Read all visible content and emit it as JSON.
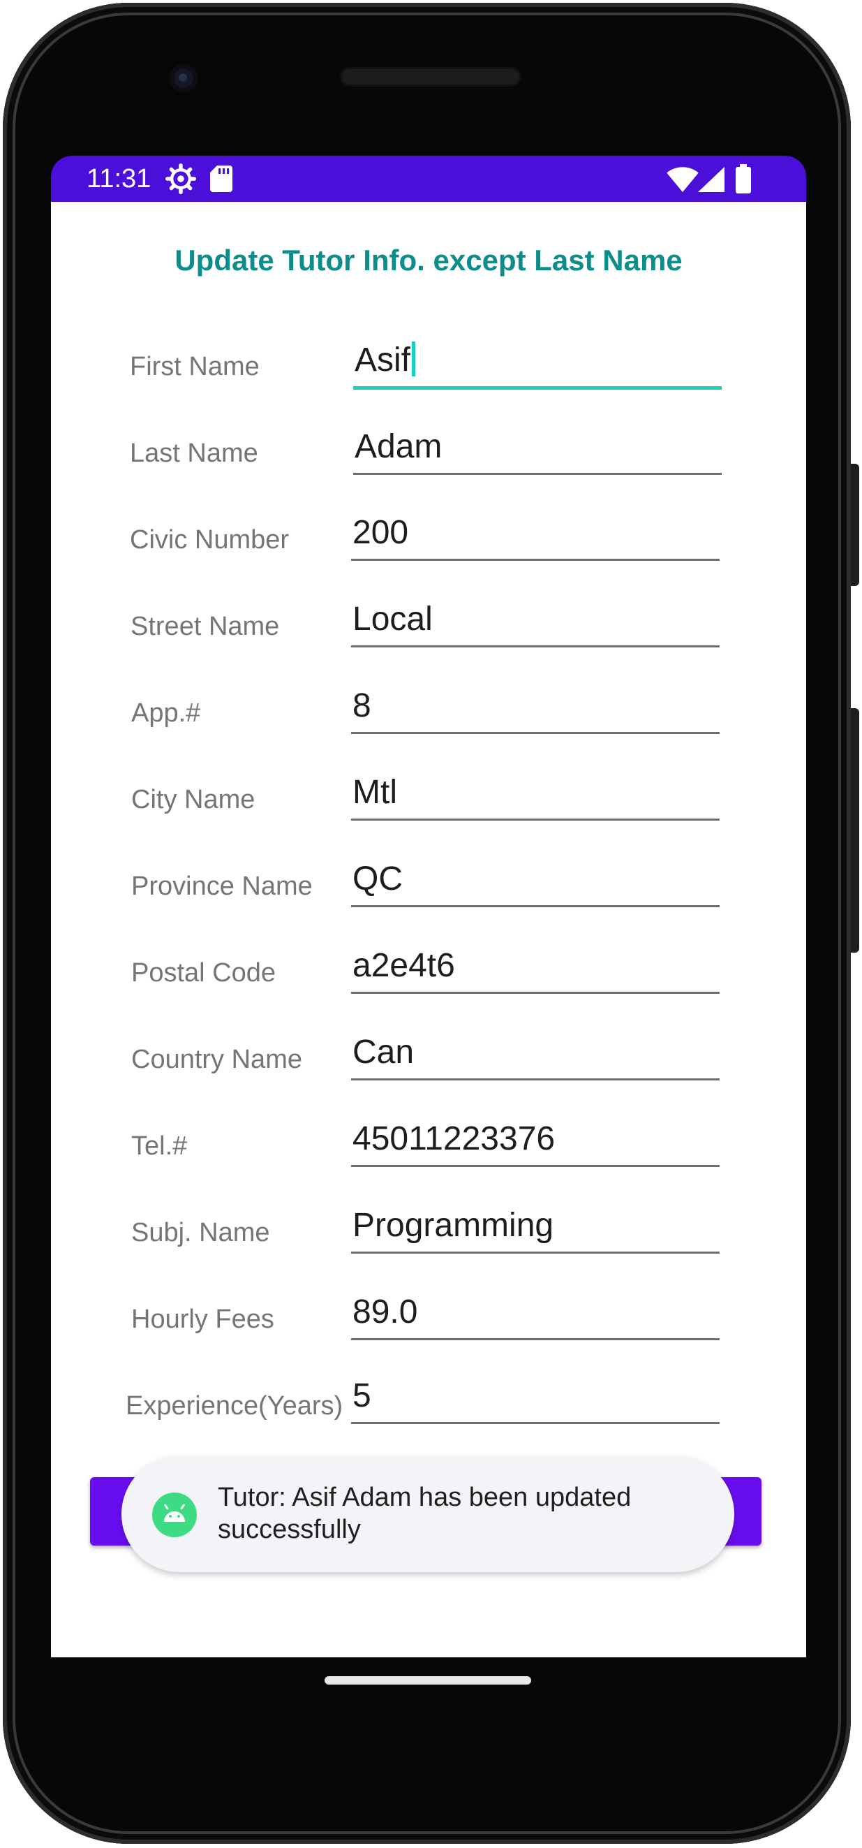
{
  "status_bar": {
    "time": "11:31",
    "left_icons": [
      "settings-icon",
      "sd-card-icon"
    ],
    "right_icons": [
      "wifi-icon",
      "signal-icon",
      "battery-icon"
    ],
    "color": "#4c0fd9"
  },
  "screen": {
    "title": "Update Tutor Info. except Last Name",
    "title_color": "#0c8c8a",
    "fields": [
      {
        "label": "First Name",
        "value": "Asif"
      },
      {
        "label": "Last Name",
        "value": "Adam"
      },
      {
        "label": "Civic Number",
        "value": "200"
      },
      {
        "label": "Street Name",
        "value": "Local"
      },
      {
        "label": "App.#",
        "value": "8"
      },
      {
        "label": "City Name",
        "value": "Mtl"
      },
      {
        "label": "Province Name",
        "value": "QC"
      },
      {
        "label": "Postal Code",
        "value": "a2e4t6"
      },
      {
        "label": "Country Name",
        "value": "Can"
      },
      {
        "label": "Tel.#",
        "value": "45011223376"
      },
      {
        "label": "Subj. Name",
        "value": "Programming"
      },
      {
        "label": "Hourly Fees",
        "value": "89.0"
      },
      {
        "label": "Experience(Years)",
        "value": "5"
      }
    ],
    "button_color": "#6a0ef2",
    "focus_color": "#1ccfc4"
  },
  "toast": {
    "icon": "android-icon",
    "message": "Tutor: Asif Adam has been updated successfully"
  }
}
